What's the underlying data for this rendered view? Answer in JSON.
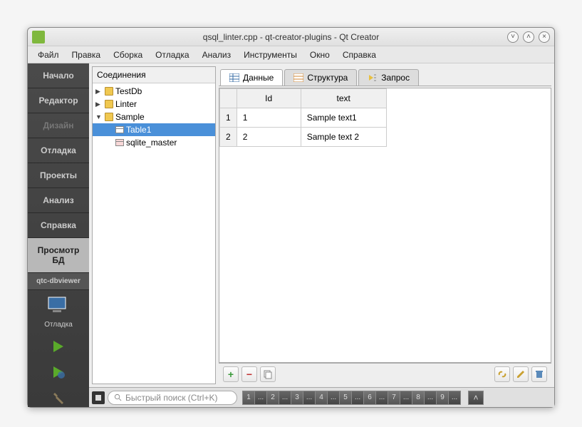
{
  "window": {
    "title": "qsql_linter.cpp - qt-creator-plugins - Qt Creator"
  },
  "menubar": {
    "items": [
      "Файл",
      "Правка",
      "Сборка",
      "Отладка",
      "Анализ",
      "Инструменты",
      "Окно",
      "Справка"
    ]
  },
  "sidebar": {
    "items": [
      {
        "label": "Начало"
      },
      {
        "label": "Редактор"
      },
      {
        "label": "Дизайн"
      },
      {
        "label": "Отладка"
      },
      {
        "label": "Проекты"
      },
      {
        "label": "Анализ"
      },
      {
        "label": "Справка"
      }
    ],
    "active_tool": "Просмотр БД",
    "project": "qtc-dbviewer",
    "debug_label": "Отладка"
  },
  "tree": {
    "header": "Соединения",
    "nodes": [
      {
        "label": "TestDb",
        "level": 1,
        "expanded": false,
        "type": "db"
      },
      {
        "label": "Linter",
        "level": 1,
        "expanded": false,
        "type": "db"
      },
      {
        "label": "Sample",
        "level": 1,
        "expanded": true,
        "type": "db"
      },
      {
        "label": "Table1",
        "level": 2,
        "type": "table",
        "selected": true
      },
      {
        "label": "sqlite_master",
        "level": 2,
        "type": "table"
      }
    ]
  },
  "tabs": {
    "items": [
      "Данные",
      "Структура",
      "Запрос"
    ],
    "active": 0
  },
  "grid": {
    "columns": [
      "Id",
      "text"
    ],
    "rows": [
      {
        "n": "1",
        "cells": [
          "1",
          "Sample text1"
        ]
      },
      {
        "n": "2",
        "cells": [
          "2",
          "Sample text 2"
        ]
      }
    ]
  },
  "statusbar": {
    "search_placeholder": "Быстрый поиск (Ctrl+K)",
    "pages": [
      "1",
      "2",
      "3",
      "4",
      "5",
      "6",
      "7",
      "8",
      "9"
    ]
  }
}
